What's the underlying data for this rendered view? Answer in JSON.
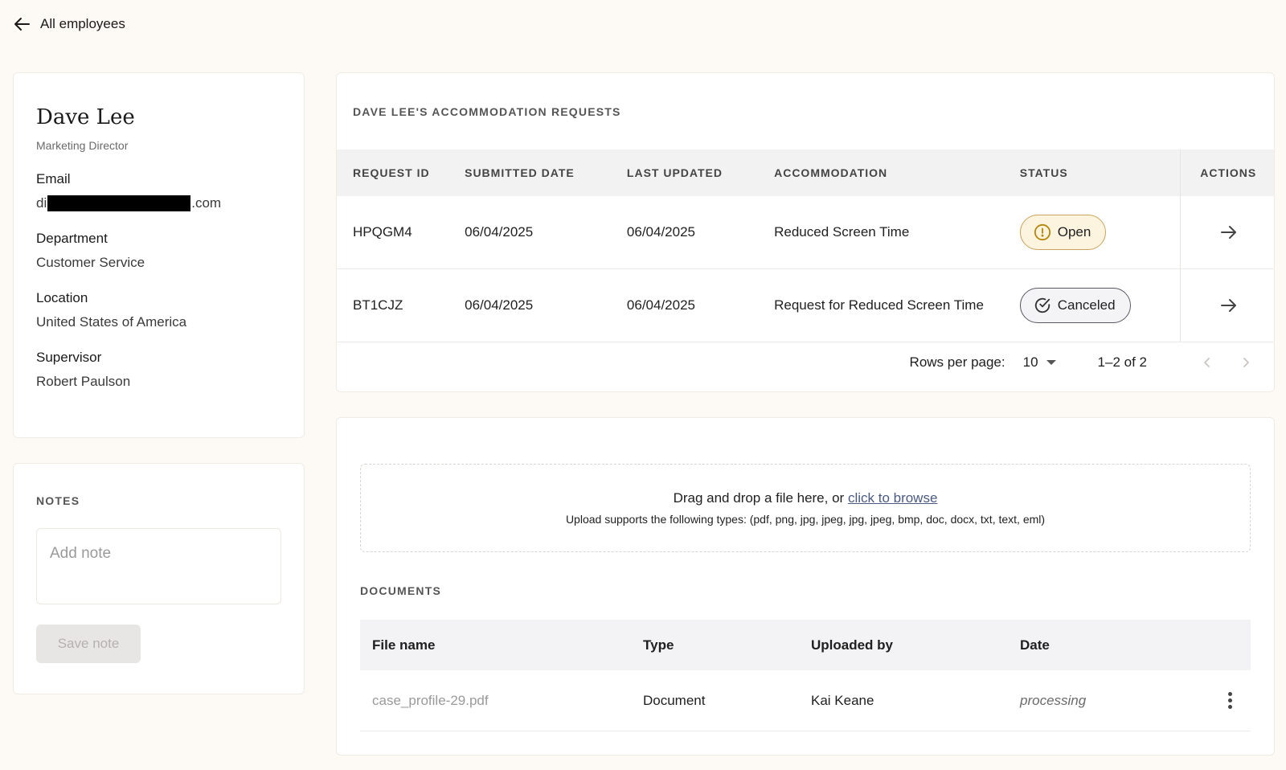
{
  "nav": {
    "back_label": "All employees"
  },
  "profile": {
    "name": "Dave Lee",
    "title": "Marketing Director",
    "email_label": "Email",
    "email_prefix": "di",
    "email_suffix": ".com",
    "department_label": "Department",
    "department": "Customer Service",
    "location_label": "Location",
    "location": "United States of America",
    "supervisor_label": "Supervisor",
    "supervisor": "Robert Paulson"
  },
  "notes": {
    "title": "NOTES",
    "placeholder": "Add note",
    "save_label": "Save note"
  },
  "requests": {
    "title": "DAVE LEE'S ACCOMMODATION REQUESTS",
    "columns": [
      "REQUEST ID",
      "SUBMITTED DATE",
      "LAST UPDATED",
      "ACCOMMODATION",
      "STATUS",
      "ACTIONS"
    ],
    "rows": [
      {
        "id": "HPQGM4",
        "submitted": "06/04/2025",
        "updated": "06/04/2025",
        "accommodation": "Reduced Screen Time",
        "status": "Open"
      },
      {
        "id": "BT1CJZ",
        "submitted": "06/04/2025",
        "updated": "06/04/2025",
        "accommodation": "Request for Reduced Screen Time",
        "status": "Canceled"
      }
    ],
    "pagination": {
      "rows_per_page_label": "Rows per page:",
      "rows_per_page": "10",
      "range": "1–2 of 2"
    }
  },
  "documents": {
    "dropzone_text": "Drag and drop a file here, or",
    "dropzone_link": "click to browse",
    "dropzone_types": "Upload supports the following types: (pdf, png, jpg, jpeg, jpg, jpeg, bmp, doc, docx, txt, text, eml)",
    "title": "DOCUMENTS",
    "columns": [
      "File name",
      "Type",
      "Uploaded by",
      "Date"
    ],
    "rows": [
      {
        "file": "case_profile-29.pdf",
        "type": "Document",
        "uploaded_by": "Kai Keane",
        "date": "processing"
      }
    ]
  },
  "colors": {
    "background": "#fdf9f5",
    "open_status_bg": "#fdf4e0",
    "open_status_border": "#c9a45c",
    "canceled_status_border": "#5a5a66",
    "link": "#4a5a80"
  }
}
